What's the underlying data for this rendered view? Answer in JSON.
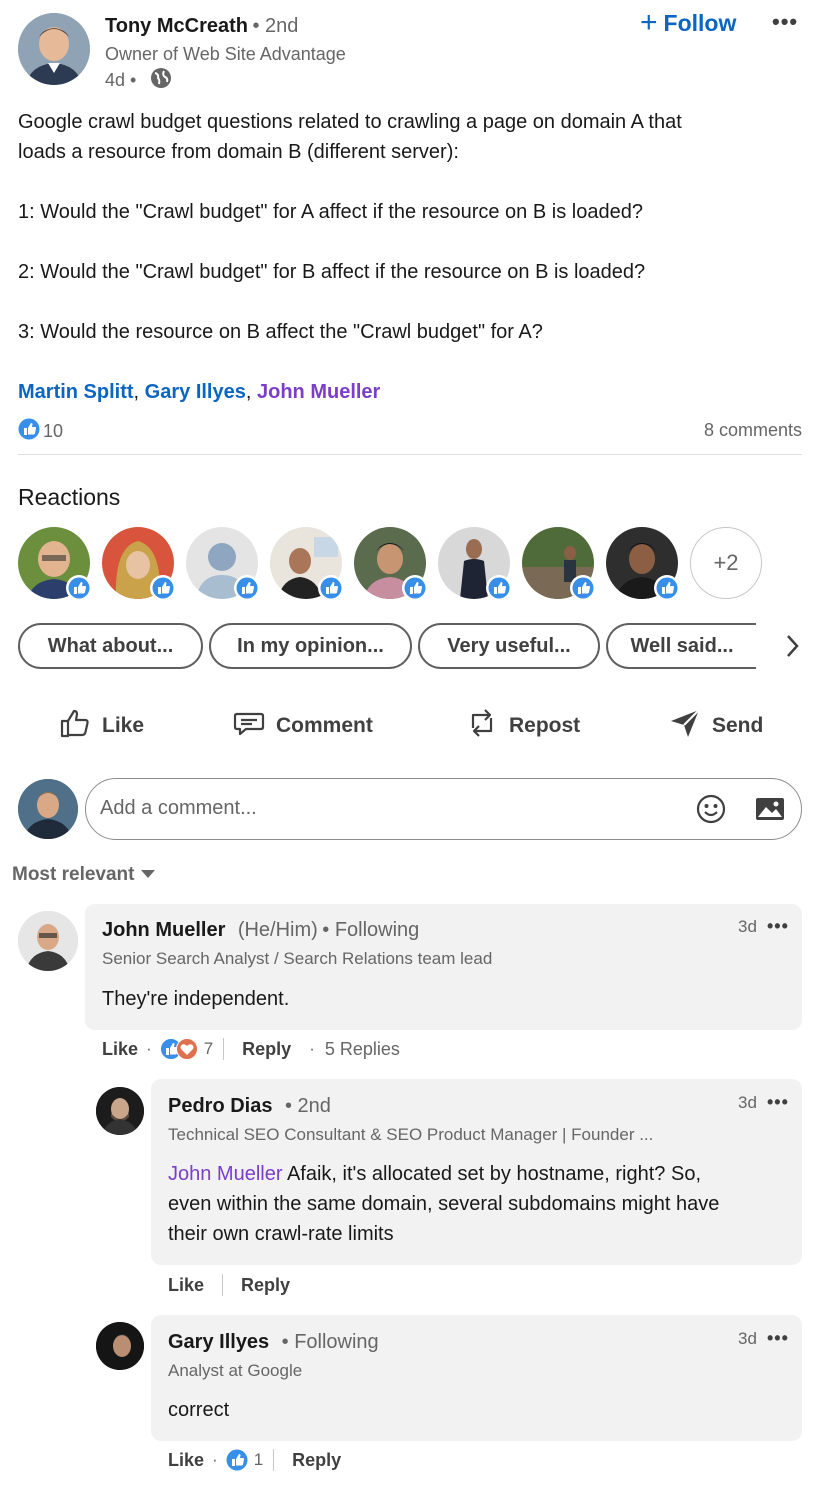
{
  "post": {
    "author": {
      "name": "Tony McCreath",
      "degree": "• 2nd",
      "headline": "Owner of Web Site Advantage",
      "time": "4d •",
      "follow_label": "Follow"
    },
    "body_lines": [
      "Google crawl budget questions related to crawling a page on domain A that",
      "loads a resource from domain B (different server):",
      "1: Would the \"Crawl budget\" for A affect if the resource on B is loaded?",
      "2: Would the \"Crawl budget\" for B affect if the resource on B is loaded?",
      "3: Would the resource on B affect the \"Crawl budget\" for A?"
    ],
    "mentions": [
      "Martin Splitt",
      "Gary Illyes",
      "John Mueller"
    ],
    "mention_sep": ",",
    "reaction_count": "10",
    "comments_count": "8 comments"
  },
  "reactions": {
    "heading": "Reactions",
    "more_label": "+2"
  },
  "suggestions": [
    "What about...",
    "In my opinion...",
    "Very useful...",
    "Well said..."
  ],
  "actions": {
    "like": "Like",
    "comment": "Comment",
    "repost": "Repost",
    "send": "Send"
  },
  "comment_box": {
    "placeholder": "Add a comment..."
  },
  "sort": {
    "label": "Most relevant"
  },
  "comments": [
    {
      "name": "John Mueller",
      "pronouns": "(He/Him)",
      "relation": "• Following",
      "headline": "Senior Search Analyst / Search Relations team lead",
      "time": "3d",
      "text": "They're independent.",
      "like_label": "Like",
      "reaction_count": "7",
      "reply_label": "Reply",
      "replies_label": "5 Replies"
    }
  ],
  "replies": [
    {
      "name": "Pedro Dias",
      "relation": "• 2nd",
      "headline": "Technical SEO Consultant & SEO Product Manager | Founder ...",
      "time": "3d",
      "mention": "John Mueller",
      "text_lines": [
        " Afaik, it's allocated set by hostname, right? So,",
        "even within the same domain, several subdomains might have",
        "their own crawl-rate limits"
      ],
      "like_label": "Like",
      "reply_label": "Reply"
    },
    {
      "name": "Gary Illyes",
      "relation": "• Following",
      "headline": "Analyst at Google",
      "time": "3d",
      "text": "correct",
      "like_label": "Like",
      "reaction_count": "1",
      "reply_label": "Reply"
    }
  ],
  "colors": {
    "accent": "#0a66c2",
    "mention_visited": "#7a3ec8",
    "like_badge": "#378fe9",
    "love_badge": "#df704d"
  }
}
